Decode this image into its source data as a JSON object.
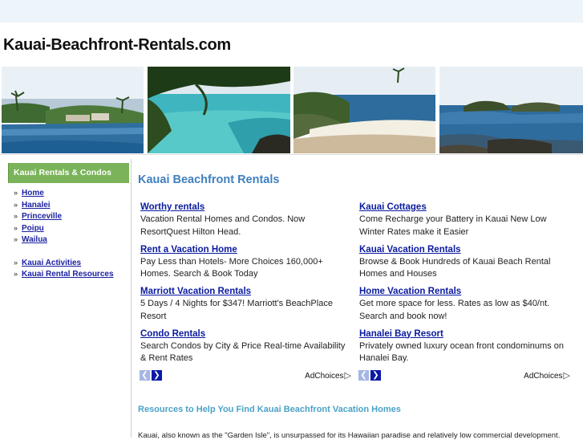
{
  "site": {
    "title": "Kauai-Beachfront-Rentals.com"
  },
  "banner": {
    "photos": [
      {
        "name": "coastal-resort-photo"
      },
      {
        "name": "turquoise-lagoon-photo"
      },
      {
        "name": "sandy-beach-cove-photo"
      },
      {
        "name": "rocky-shoreline-photo"
      }
    ]
  },
  "sidebar": {
    "heading": "Kauai Rentals & Condos",
    "links": [
      "Home",
      "Hanalei",
      "Princeville",
      "Poipu",
      "Wailua"
    ],
    "extra_links": [
      "Kauai Activities",
      "Kauai Rental Resources"
    ]
  },
  "main": {
    "heading": "Kauai Beachfront Rentals",
    "ads_left": [
      {
        "title": "Worthy rentals",
        "text": "Vacation Rental Homes and Condos. Now ResortQuest Hilton Head."
      },
      {
        "title": "Rent a Vacation Home",
        "text": "Pay Less than Hotels- More Choices 160,000+ Homes. Search & Book Today"
      },
      {
        "title": "Marriott Vacation Rentals",
        "text": "5 Days / 4 Nights for $347! Marriott's BeachPlace Resort"
      },
      {
        "title": "Condo Rentals",
        "text": "Search Condos by City & Price Real-time Availability & Rent Rates"
      }
    ],
    "ads_right": [
      {
        "title": "Kauai Cottages",
        "text": "Come Recharge your Battery in Kauai New Low Winter Rates make it Easier"
      },
      {
        "title": "Kauai Vacation Rentals",
        "text": "Browse & Book Hundreds of Kauai Beach Rental Homes and Houses"
      },
      {
        "title": "Home Vacation Rentals",
        "text": "Get more space for less. Rates as low as $40/nt. Search and book now!"
      },
      {
        "title": "Hanalei Bay Resort",
        "text": "Privately owned luxury ocean front condominums on Hanalei Bay."
      }
    ],
    "adchoices_label": "AdChoices",
    "resources_heading": "Resources to Help You Find Kauai Beachfront Vacation Homes",
    "intro": "Kauai, also known as the \"Garden Isle\", is unsurpassed for its Hawaiian paradise and relatively low commercial development."
  }
}
